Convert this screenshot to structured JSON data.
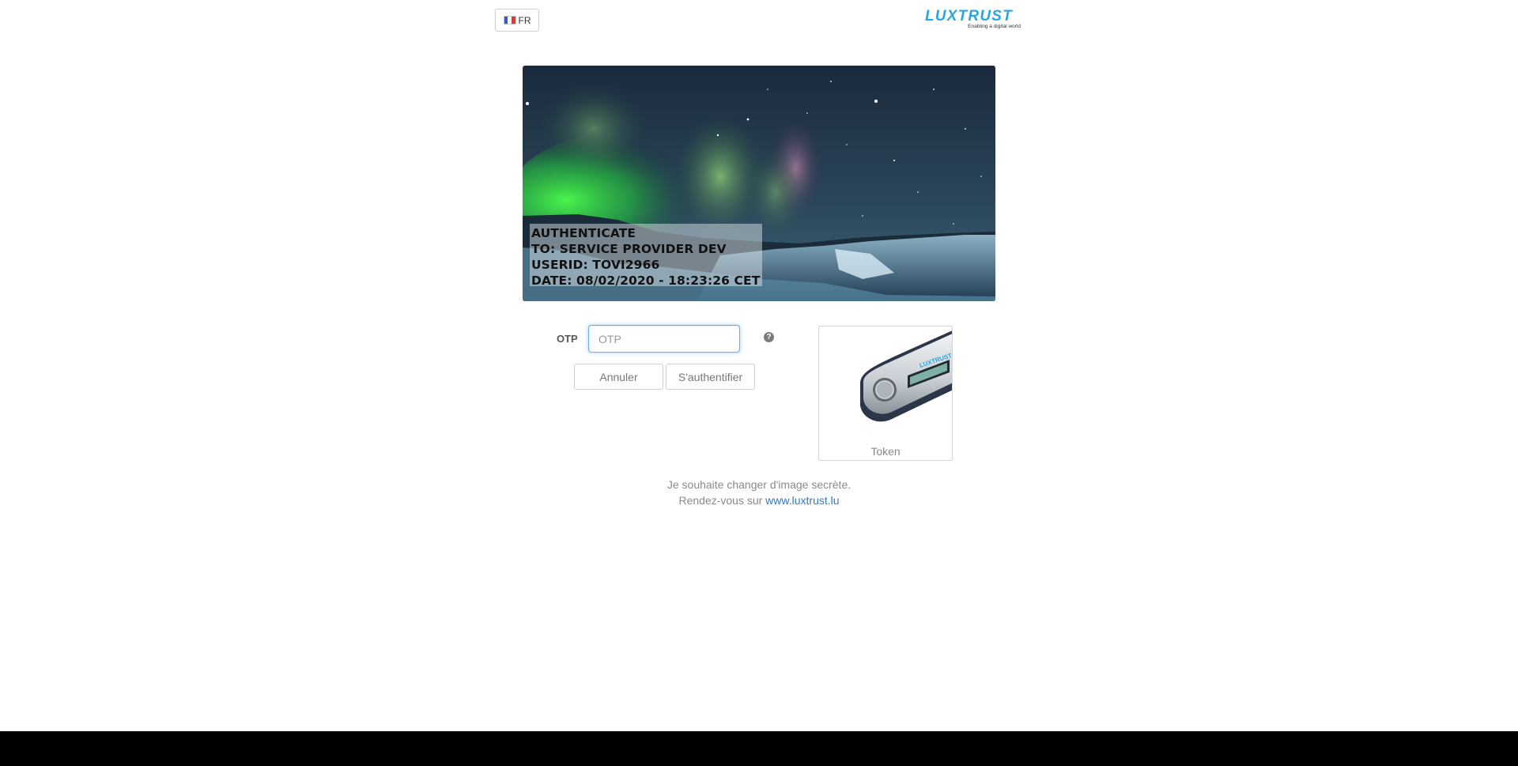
{
  "language": {
    "code": "FR",
    "flag_colors": [
      "#3a57c8",
      "#ffffff",
      "#e0373c"
    ]
  },
  "logo": {
    "word": "LUXTRUST",
    "tagline": "Enabling a digital world",
    "color": "#29a6e0"
  },
  "secret_image": {
    "lines": [
      "AUTHENTICATE",
      "TO: SERVICE PROVIDER DEV",
      "USERID: TOVI2966",
      "DATE: 08/02/2020 - 18:23:26 CET"
    ]
  },
  "form": {
    "otp_label": "OTP",
    "otp_placeholder": "OTP",
    "otp_value": "",
    "help_icon": "question-circle-icon",
    "cancel_label": "Annuler",
    "submit_label": "S'authentifier"
  },
  "token": {
    "label": "Token",
    "brand": "LUXTRUST"
  },
  "footer": {
    "line1": "Je souhaite changer d'image secrète.",
    "line2_prefix": "Rendez-vous sur",
    "link_text": "www.luxtrust.lu"
  }
}
